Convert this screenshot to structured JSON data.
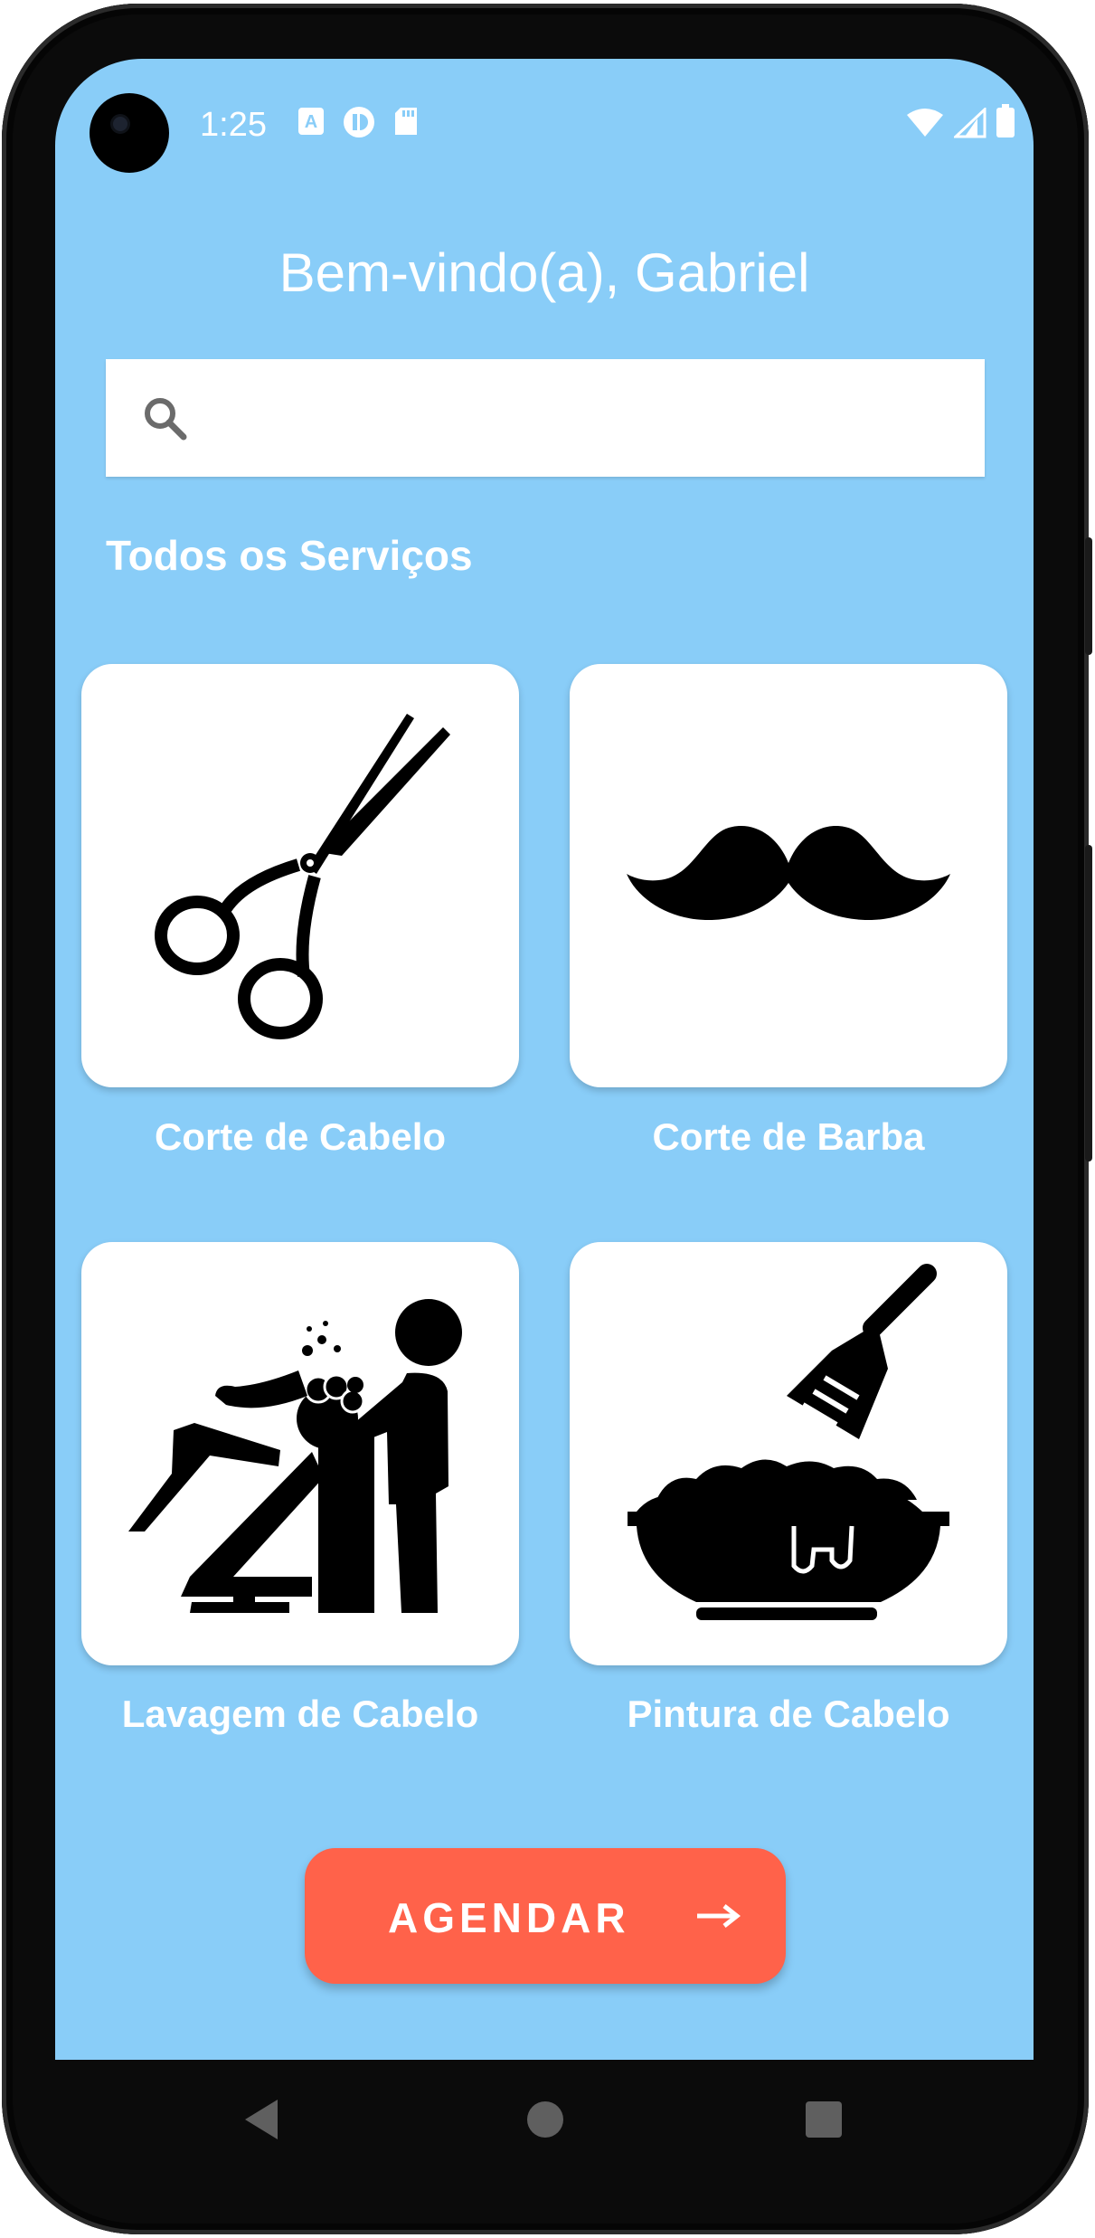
{
  "status_bar": {
    "time": "1:25",
    "left_icons": [
      "font-icon",
      "app-notification-icon",
      "sd-card-icon"
    ],
    "right_icons": [
      "wifi-icon",
      "cell-signal-icon",
      "battery-icon"
    ]
  },
  "header": {
    "welcome": "Bem-vindo(a), Gabriel"
  },
  "search": {
    "placeholder": "",
    "value": ""
  },
  "services": {
    "section_title": "Todos os Serviços",
    "items": [
      {
        "label": "Corte de Cabelo",
        "icon": "scissors-icon"
      },
      {
        "label": "Corte de Barba",
        "icon": "mustache-icon"
      },
      {
        "label": "Lavagem de Cabelo",
        "icon": "hair-wash-icon"
      },
      {
        "label": "Pintura de Cabelo",
        "icon": "hair-dye-bowl-icon"
      }
    ]
  },
  "actions": {
    "book_label": "AGENDAR"
  },
  "nav": {
    "icons": [
      "back-icon",
      "home-icon",
      "recents-icon"
    ]
  },
  "colors": {
    "background": "#89cdf8",
    "button": "#ff624a",
    "card": "#ffffff"
  }
}
